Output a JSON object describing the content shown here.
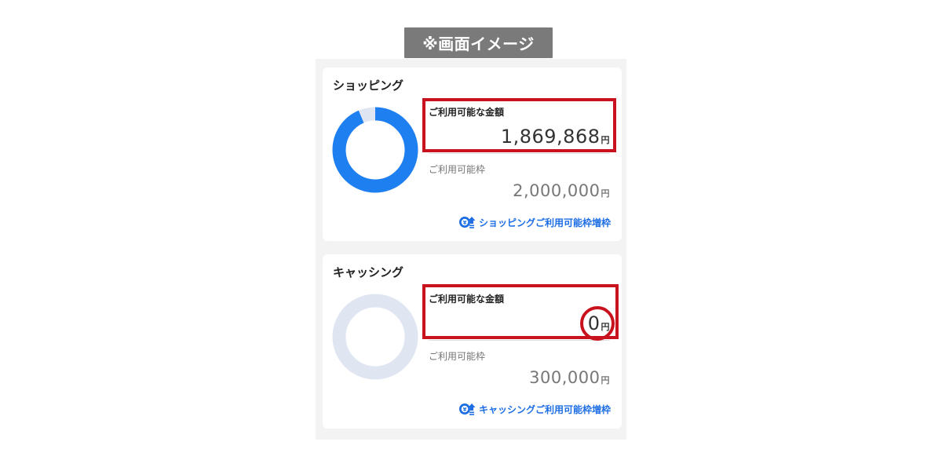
{
  "image_label": "※画面イメージ",
  "colors": {
    "accent_blue": "#1d7ff0",
    "donut_track": "#dfe6f2",
    "link_blue": "#1d6ee5",
    "highlight_red": "#c8121d"
  },
  "shopping": {
    "title": "ショッピング",
    "available_label": "ご利用可能な金額",
    "available_amount": "1,869,868",
    "available_unit": "円",
    "limit_label": "ご利用可能枠",
    "limit_amount": "2,000,000",
    "limit_unit": "円",
    "usage_ratio": 0.934934,
    "increase_link": "ショッピングご利用可能枠増枠",
    "increase_icon": "credit-limit-up-icon"
  },
  "cashing": {
    "title": "キャッシング",
    "available_label": "ご利用可能な金額",
    "available_amount": "0",
    "available_unit": "円",
    "limit_label": "ご利用可能枠",
    "limit_amount": "300,000",
    "limit_unit": "円",
    "usage_ratio": 0,
    "increase_link": "キャッシングご利用可能枠増枠",
    "increase_icon": "credit-limit-up-icon"
  }
}
